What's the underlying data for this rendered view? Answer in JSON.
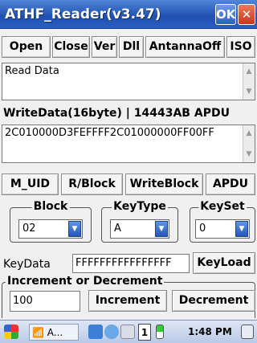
{
  "window": {
    "title": "ATHF_Reader(v3.47)",
    "ok_label": "OK",
    "close_glyph": "✕"
  },
  "toolbar": {
    "buttons": [
      "Open",
      "Close",
      "Ver",
      "Dll",
      "AntannaOff",
      "ISO"
    ]
  },
  "read_data": {
    "value": "Read Data"
  },
  "write_section": {
    "label": "WriteData(16byte) | 14443AB APDU",
    "value": "2C010000D3FEFFFF2C01000000FF00FF"
  },
  "actions": {
    "buttons": [
      "M_UID",
      "R/Block",
      "WriteBlock",
      "APDU"
    ]
  },
  "groups": {
    "block": {
      "title": "Block",
      "selected": "02"
    },
    "key_type": {
      "title": "KeyType",
      "selected": "A"
    },
    "key_set": {
      "title": "KeySet",
      "selected": "0"
    }
  },
  "key_data": {
    "label": "KeyData",
    "value": "FFFFFFFFFFFFFFFF",
    "load_button": "KeyLoad"
  },
  "inc_dec": {
    "title": "Increment or Decrement",
    "value": "100",
    "increment_button": "Increment",
    "decrement_button": "Decrement"
  },
  "taskbar": {
    "app_label": "A...",
    "tray_number": "1",
    "time": "1:48 PM"
  },
  "colors": {
    "title_bar": "#1f4fb0",
    "ok_button": "#2c5fc2",
    "close_button": "#c8361a",
    "taskbar": "#b9c9e6"
  },
  "icons": [
    "start-icon",
    "wireless-icon",
    "network-icon",
    "bluetooth-icon",
    "battery-icon",
    "keyboard-icon"
  ]
}
